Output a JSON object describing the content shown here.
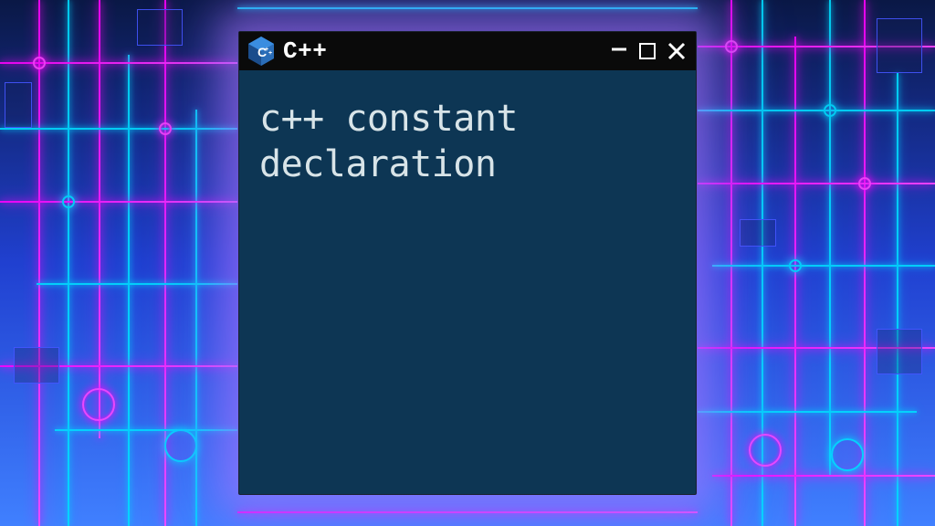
{
  "window": {
    "title": "C++",
    "icon": "cpp-logo-icon"
  },
  "content": {
    "text": "c++ constant declaration"
  },
  "controls": {
    "minimize": "—",
    "maximize": "□",
    "close": "×"
  },
  "colors": {
    "neon_magenta": "#ff00ff",
    "neon_cyan": "#00ddff",
    "window_bg": "#0d3654",
    "titlebar_bg": "#0a0a0a"
  }
}
